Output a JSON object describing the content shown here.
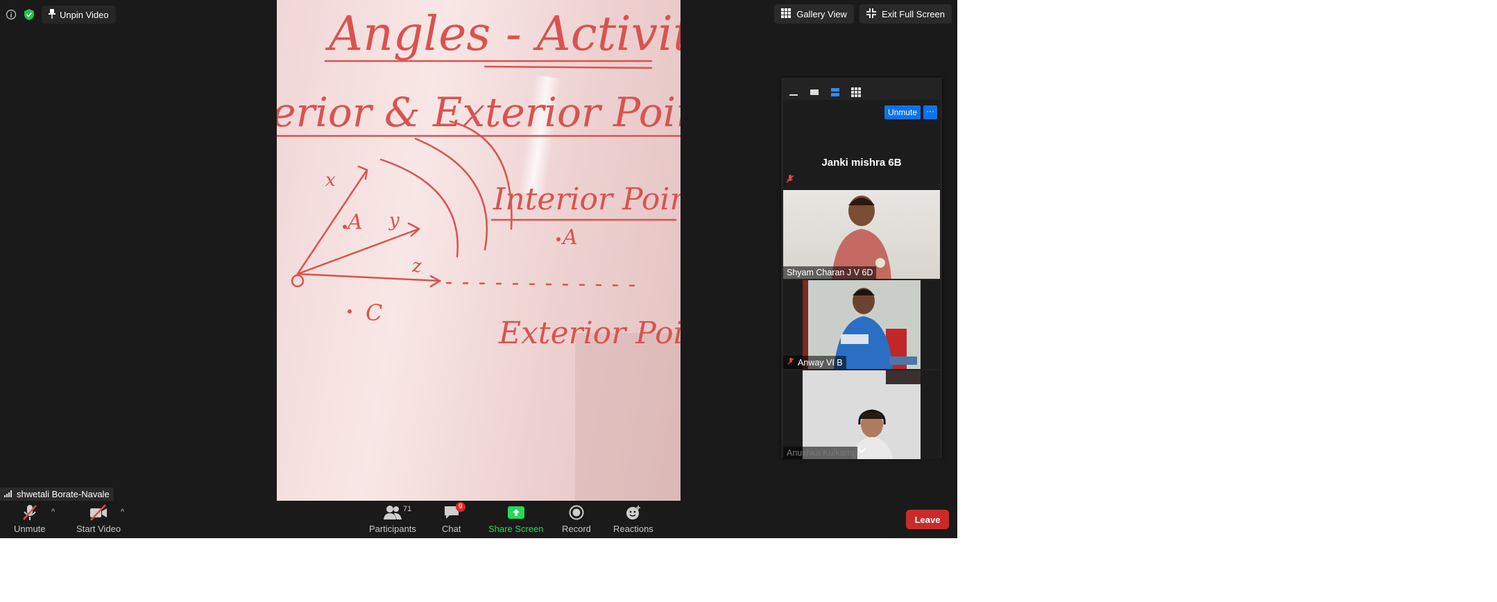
{
  "top_left": {
    "pin_label": "Unpin Video"
  },
  "top_right": {
    "gallery_label": "Gallery View",
    "exit_fullscreen_label": "Exit Full Screen"
  },
  "shared_content": {
    "heading": "Angles - Activity",
    "subheading": "terior & Exterior Points.",
    "interior_label": "Interior Points",
    "exterior_label": "Exterior Points",
    "point_a": "A",
    "point_a2": "A",
    "point_c": "C",
    "ray_x": "x",
    "ray_y": "y",
    "ray_z": "z"
  },
  "panel": {
    "active_speaker": {
      "name": "Janki mishra 6B",
      "unmute_label": "Unmute",
      "more_label": "···"
    },
    "participants": [
      {
        "name": "Shyam Charan J V 6D",
        "muted": false
      },
      {
        "name": "Anway VI B",
        "muted": true
      },
      {
        "name": "Anushka Kulkarni",
        "muted": false
      }
    ]
  },
  "self_view": {
    "name": "shwetali Borate-Navale"
  },
  "toolbar": {
    "unmute": "Unmute",
    "start_video": "Start Video",
    "participants": "Participants",
    "participants_count": "71",
    "chat": "Chat",
    "chat_badge": "9",
    "share_screen": "Share Screen",
    "record": "Record",
    "reactions": "Reactions",
    "leave": "Leave"
  },
  "colors": {
    "accent_blue": "#0e72ed",
    "share_green": "#23d959",
    "leave_red": "#c92a2a",
    "ink_red": "#d9534f"
  },
  "icons": [
    "info-icon",
    "shield-icon",
    "pin-icon",
    "grid-icon",
    "exit-fullscreen-icon",
    "mic-muted-icon",
    "video-off-icon",
    "participants-icon",
    "chat-icon",
    "share-screen-icon",
    "record-icon",
    "reactions-icon",
    "signal-icon",
    "chevron-down-icon"
  ]
}
